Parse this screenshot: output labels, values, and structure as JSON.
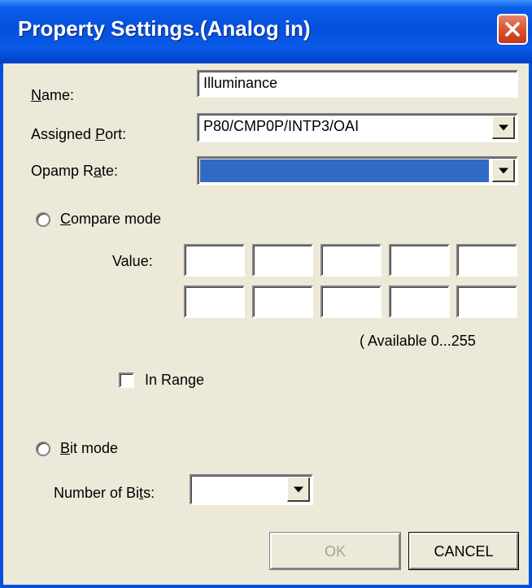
{
  "window": {
    "title": "Property Settings.(Analog in)"
  },
  "name_field": {
    "label_u": "N",
    "label_rest": "ame:",
    "value": "Illuminance"
  },
  "port_field": {
    "label_pre": "Assigned ",
    "label_u": "P",
    "label_rest": "ort:",
    "value": "P80/CMP0P/INTP3/OAI"
  },
  "opamp_field": {
    "label_pre": "Opamp R",
    "label_u": "a",
    "label_rest": "te:",
    "value": "",
    "highlight": "#316AC5"
  },
  "compare_mode": {
    "label_u": "C",
    "label_rest": "ompare mode",
    "selected": false,
    "value_label": "Value:",
    "values_row1": [
      "",
      "",
      "",
      "",
      ""
    ],
    "values_row2": [
      "",
      "",
      "",
      "",
      ""
    ],
    "available_text": "( Available  0...255",
    "in_range_label": "In Range",
    "in_range_checked": false
  },
  "bit_mode": {
    "label_u": "B",
    "label_rest": "it mode",
    "selected": false,
    "bits_label_pre": "Number of Bi",
    "bits_label_u": "t",
    "bits_label_rest": "s:",
    "bits_value": ""
  },
  "buttons": {
    "ok": "OK",
    "ok_enabled": false,
    "cancel": "CANCEL"
  },
  "icons": {
    "close": "close-icon",
    "dropdown": "dropdown-arrow-icon"
  },
  "colors": {
    "title_bar": "#0550DC",
    "close_button": "#D7512D",
    "dialog_bg": "#ECE9D8"
  }
}
